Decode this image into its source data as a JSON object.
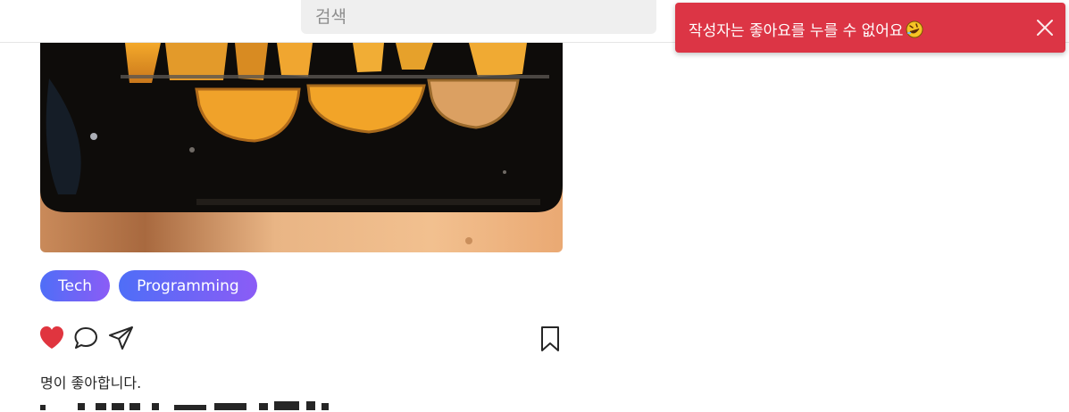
{
  "search": {
    "placeholder": "검색",
    "value": ""
  },
  "post": {
    "image_alt": "roasted squash slices on a black baking tray",
    "tags": [
      "Tech",
      "Programming"
    ],
    "likes_text": "명이 좋아합니다.",
    "liked": true
  },
  "icons": {
    "like": "heart-icon",
    "comment": "comment-bubble-icon",
    "share": "paper-plane-icon",
    "save": "bookmark-icon",
    "close": "close-icon",
    "emoji": "rolling-on-floor-laughing-emoji-icon"
  },
  "toast": {
    "message": "작성자는 좋아요를 누를 수 없어요",
    "color": "#dc3545"
  },
  "colors": {
    "heart": "#e0353f",
    "tag_gradient_start": "#4f6ef7",
    "tag_gradient_end": "#8b5cf6"
  }
}
